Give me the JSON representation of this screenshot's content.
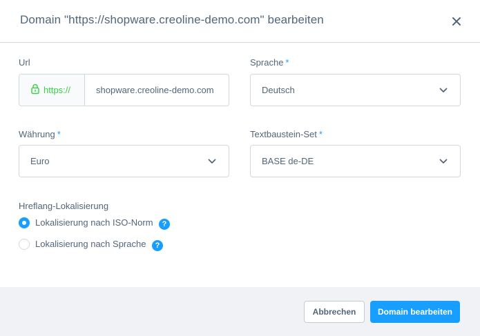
{
  "modal": {
    "title": "Domain \"https://shopware.creoline-demo.com\" bearbeiten",
    "close_icon": "close-icon"
  },
  "form": {
    "url": {
      "label": "Url",
      "prefix": "https://",
      "prefix_icon": "lock-icon",
      "value": "shopware.creoline-demo.com"
    },
    "language": {
      "label": "Sprache",
      "required_mark": "*",
      "value": "Deutsch"
    },
    "currency": {
      "label": "Währung",
      "required_mark": "*",
      "value": "Euro"
    },
    "snippet_set": {
      "label": "Textbaustein-Set",
      "required_mark": "*",
      "value": "BASE de-DE"
    },
    "hreflang": {
      "label": "Hreflang-Lokalisierung",
      "options": [
        {
          "label": "Lokalisierung nach ISO-Norm",
          "checked": true,
          "help": "?"
        },
        {
          "label": "Lokalisierung nach Sprache",
          "checked": false,
          "help": "?"
        }
      ]
    }
  },
  "footer": {
    "cancel_label": "Abbrechen",
    "submit_label": "Domain bearbeiten"
  },
  "colors": {
    "accent": "#189eff",
    "secure_green": "#37d046",
    "text": "#52667a",
    "border": "#d1d9e0",
    "footer_bg": "#f0f2f5"
  }
}
